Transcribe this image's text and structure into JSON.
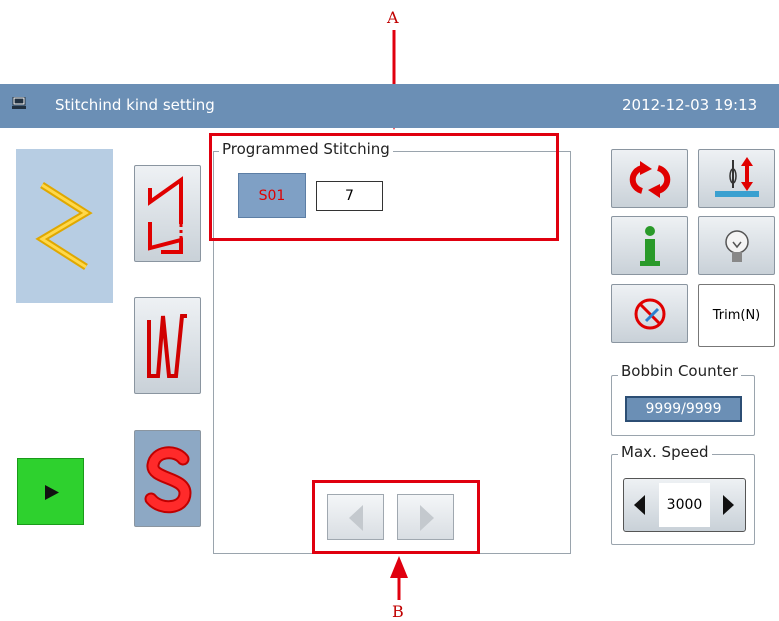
{
  "annotations": {
    "label_a": "A",
    "label_b": "B"
  },
  "titlebar": {
    "title": "Stitchind kind setting",
    "datetime": "2012-12-03  19:13"
  },
  "program_panel": {
    "title": "Programmed Stitching",
    "pattern_button": "S01",
    "value": "7"
  },
  "right_tools": {
    "trim_label": "Trim(N)"
  },
  "bobbin_counter": {
    "title": "Bobbin Counter",
    "value": "9999/9999"
  },
  "max_speed": {
    "title": "Max. Speed",
    "value": "3000"
  },
  "colors": {
    "titlebar": "#6b8fb5",
    "accent_red": "#e00000",
    "selected_pattern_bg": "#b7cde3",
    "play_green": "#2ed12e",
    "annotation_red": "#e0000f"
  }
}
